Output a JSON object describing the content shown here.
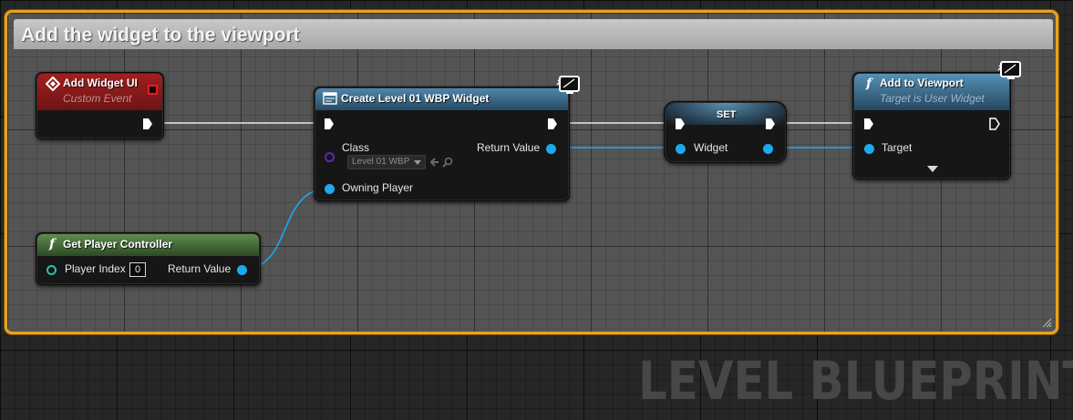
{
  "comment": {
    "title": "Add the widget to the viewport"
  },
  "nodes": {
    "add_widget_ui": {
      "title": "Add Widget UI",
      "subtitle": "Custom Event"
    },
    "create_widget": {
      "title": "Create Level 01 WBP Widget",
      "class_label": "Class",
      "class_value": "Level 01 WBP",
      "owning_player_label": "Owning Player",
      "return_label": "Return Value"
    },
    "set_node": {
      "title": "SET",
      "widget_label": "Widget"
    },
    "add_to_viewport": {
      "title": "Add to Viewport",
      "subtitle": "Target is User Widget",
      "target_label": "Target"
    },
    "get_player_controller": {
      "title": "Get Player Controller",
      "player_index_label": "Player Index",
      "player_index_value": "0",
      "return_label": "Return Value"
    }
  },
  "watermark": "LEVEL BLUEPRINT",
  "colors": {
    "comment_border": "#e9a21f",
    "event_header": "#8f1b1b",
    "function_header": "#3a7ba4",
    "pure_header": "#4c7a3c",
    "object_pin": "#1da8ef",
    "exec_pin": "#ffffff"
  },
  "icons": {
    "event": "event-diamond-icon",
    "create_widget": "widget-blueprint-icon",
    "function": "function-f-icon",
    "client_server": "monitor-icon"
  }
}
